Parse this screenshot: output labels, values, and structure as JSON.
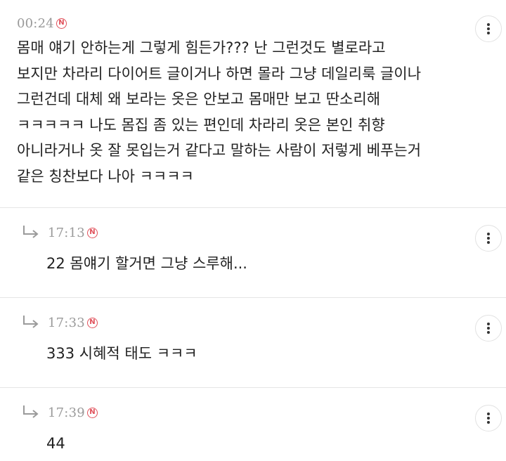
{
  "comments": [
    {
      "time": "00:24",
      "badge": "N",
      "lines": [
        "몸매 얘기 안하는게 그렇게 힘든가??? 난 그런것도 별로라고",
        "보지만 차라리 다이어트 글이거나 하면 몰라 그냥 데일리룩 글이나",
        "그런건데 대체 왜 보라는 옷은 안보고 몸매만 보고 딴소리해",
        "ㅋㅋㅋㅋㅋ 나도 몸집 좀 있는 편인데 차라리 옷은 본인 취향",
        "아니라거나 옷 잘 못입는거 같다고 말하는 사람이 저렇게 베푸는거",
        "같은 칭찬보다 나아 ㅋㅋㅋㅋ"
      ]
    }
  ],
  "replies": [
    {
      "time": "17:13",
      "badge": "N",
      "text": "22 몸얘기 할거면 그냥 스루해..."
    },
    {
      "time": "17:33",
      "badge": "N",
      "text": "333 시혜적 태도 ㅋㅋㅋ"
    },
    {
      "time": "17:39",
      "badge": "N",
      "text": "44"
    }
  ],
  "icons": {
    "more": "vertical-dots-icon",
    "reply": "reply-arrow-icon",
    "new": "new-badge-icon"
  },
  "colors": {
    "badge": "#e0505a",
    "time": "#9a9a9a",
    "divider": "#e5e5e5",
    "text": "#222222"
  }
}
